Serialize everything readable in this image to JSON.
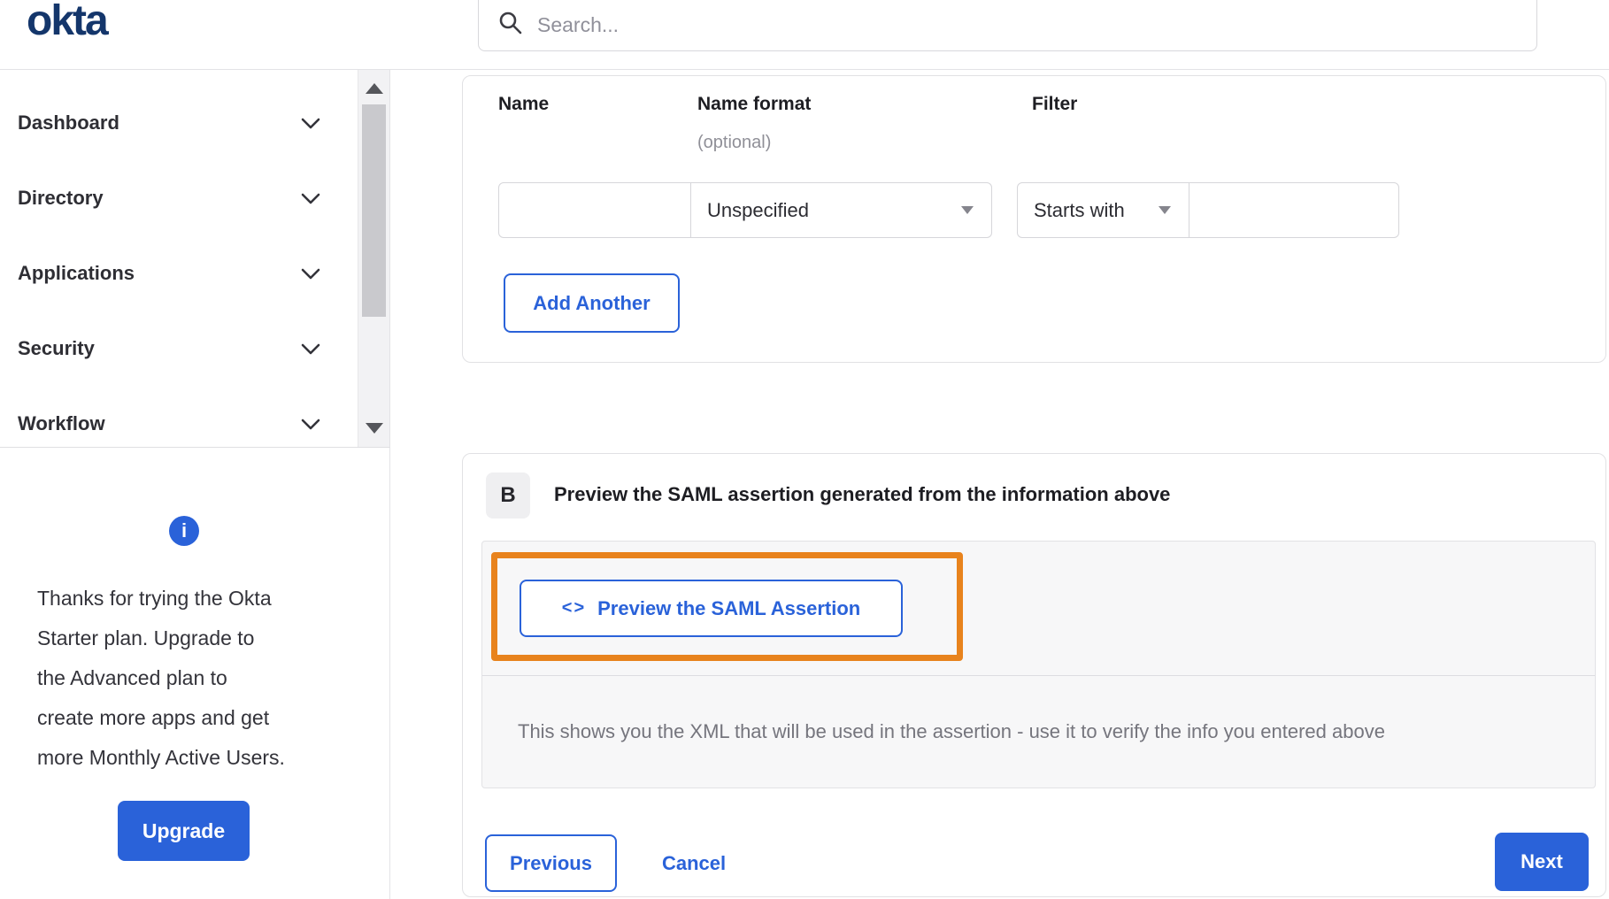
{
  "header": {
    "logo": "okta",
    "search_placeholder": "Search..."
  },
  "sidebar": {
    "items": [
      {
        "label": "Dashboard"
      },
      {
        "label": "Directory"
      },
      {
        "label": "Applications"
      },
      {
        "label": "Security"
      },
      {
        "label": "Workflow"
      }
    ],
    "promo": {
      "info_glyph": "i",
      "lines": [
        "Thanks for trying the Okta",
        "Starter plan. Upgrade to",
        "the Advanced plan to",
        "create more apps and get",
        "more Monthly Active Users."
      ],
      "upgrade_label": "Upgrade"
    }
  },
  "attribute_form": {
    "name_label": "Name",
    "name_format_label": "Name format",
    "name_format_hint": "(optional)",
    "filter_label": "Filter",
    "name_value": "",
    "name_format_selected": "Unspecified",
    "filter_op_selected": "Starts with",
    "filter_value": "",
    "add_another_label": "Add Another"
  },
  "preview_section": {
    "badge": "B",
    "title": "Preview the SAML assertion generated from the information above",
    "code_icon_glyph": "<>",
    "preview_button_label": "Preview the SAML Assertion",
    "description": "This shows you the XML that will be used in the assertion - use it to verify the info you entered above"
  },
  "footer": {
    "previous_label": "Previous",
    "cancel_label": "Cancel",
    "next_label": "Next"
  },
  "colors": {
    "brand_navy": "#14366b",
    "action_blue": "#2a62d9",
    "highlight_orange": "#e8831d"
  }
}
